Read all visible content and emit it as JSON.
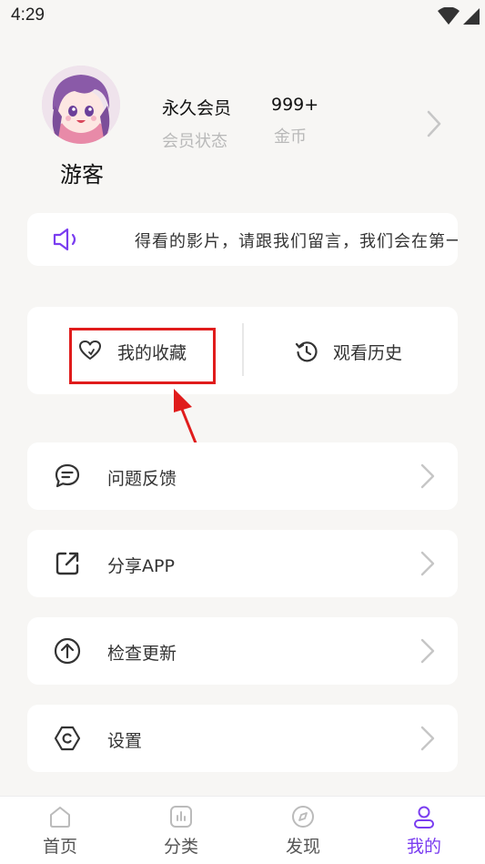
{
  "status_bar": {
    "time": "4:29"
  },
  "profile": {
    "username": "游客",
    "member_value": "永久会员",
    "member_label": "会员状态",
    "coins_value": "999+",
    "coins_label": "金币"
  },
  "notice": {
    "text": "得看的影片，请跟我们留言，我们会在第一"
  },
  "quick_actions": {
    "favorites_label": "我的收藏",
    "history_label": "观看历史"
  },
  "menu": [
    {
      "label": "问题反馈",
      "icon": "feedback-icon"
    },
    {
      "label": "分享APP",
      "icon": "share-icon"
    },
    {
      "label": "检查更新",
      "icon": "update-icon"
    },
    {
      "label": "设置",
      "icon": "settings-icon"
    }
  ],
  "tabbar": {
    "tabs": [
      {
        "label": "首页",
        "icon": "home-icon"
      },
      {
        "label": "分类",
        "icon": "category-icon"
      },
      {
        "label": "发现",
        "icon": "compass-icon"
      },
      {
        "label": "我的",
        "icon": "user-icon"
      }
    ],
    "active": "我的"
  },
  "colors": {
    "accent": "#7a3df0",
    "highlight": "#e01c1c",
    "background": "#f7f6f4"
  }
}
